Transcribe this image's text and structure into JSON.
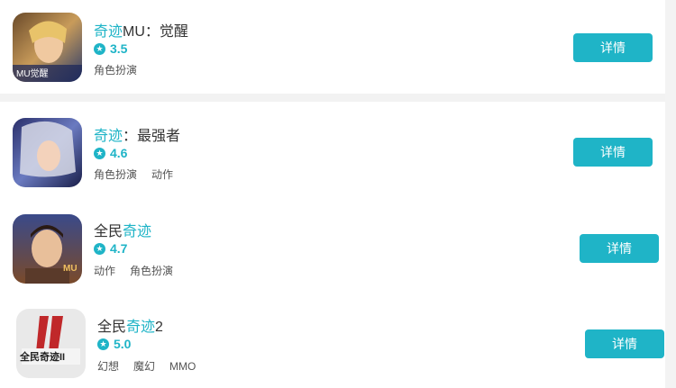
{
  "apps": [
    {
      "title_highlight": "奇迹",
      "title_rest": "MU：觉醒",
      "rating": "3.5",
      "tags": [
        "角色扮演"
      ],
      "button": "详情",
      "icon_name": "mu-awakening-icon",
      "icon_badge": "MU觉醒"
    },
    {
      "title_highlight": "奇迹",
      "title_rest": "：最强者",
      "rating": "4.6",
      "tags": [
        "角色扮演",
        "动作"
      ],
      "button": "详情",
      "icon_name": "strongest-icon"
    },
    {
      "title_prefix": "全民",
      "title_highlight": "奇迹",
      "rating": "4.7",
      "tags": [
        "动作",
        "角色扮演"
      ],
      "button": "详情",
      "icon_name": "quanmin-qiji-icon",
      "icon_badge": "MU"
    },
    {
      "title_prefix": "全民",
      "title_highlight": "奇迹",
      "title_rest": "2",
      "rating": "5.0",
      "tags": [
        "幻想",
        "魔幻",
        "MMO"
      ],
      "button": "详情",
      "icon_name": "quanmin-qiji-2-icon",
      "icon_badge": "全民奇迹II"
    }
  ],
  "colors": {
    "accent": "#1fb4c7"
  }
}
